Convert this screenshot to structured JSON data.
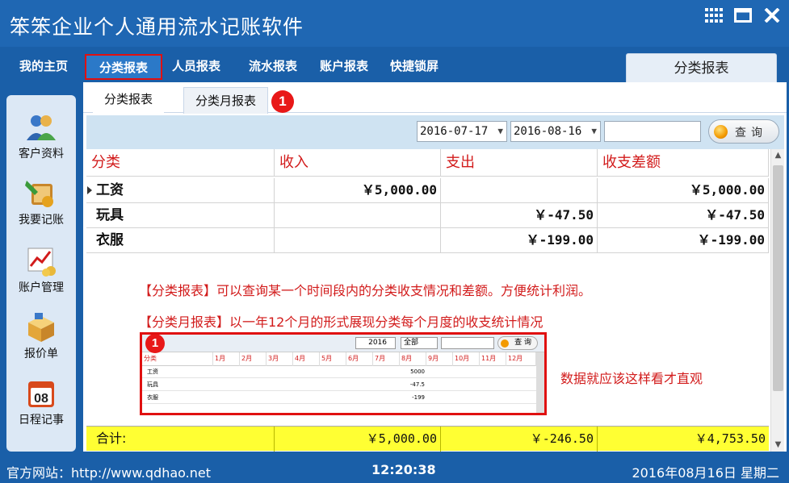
{
  "app": {
    "title": "笨笨企业个人通用流水记账软件"
  },
  "window_buttons": [
    "grid-icon",
    "maximize-icon",
    "close-icon"
  ],
  "nav": {
    "items": [
      "我的主页",
      "分类报表",
      "人员报表",
      "流水报表",
      "账户报表",
      "快捷锁屏"
    ],
    "active": "分类报表",
    "current_tab": "分类报表"
  },
  "sidebar": {
    "items": [
      {
        "label": "客户资料",
        "icon": "customer-icon"
      },
      {
        "label": "我要记账",
        "icon": "bookkeeping-icon"
      },
      {
        "label": "账户管理",
        "icon": "account-chart-icon"
      },
      {
        "label": "报价单",
        "icon": "quotation-box-icon"
      },
      {
        "label": "日程记事",
        "icon": "calendar-icon"
      }
    ]
  },
  "subtabs": {
    "items": [
      "分类报表",
      "分类月报表"
    ],
    "badge": "1"
  },
  "toolbar": {
    "start_date": "2016-07-17",
    "end_date": "2016-08-16",
    "search_value": "",
    "query_label": "查询"
  },
  "table": {
    "columns": [
      "分类",
      "收入",
      "支出",
      "收支差额"
    ],
    "rows": [
      {
        "category": "工资",
        "income": "￥5,000.00",
        "expense": "",
        "balance": "￥5,000.00"
      },
      {
        "category": "玩具",
        "income": "",
        "expense": "￥-47.50",
        "balance": "￥-47.50"
      },
      {
        "category": "衣服",
        "income": "",
        "expense": "￥-199.00",
        "balance": "￥-199.00"
      }
    ],
    "total": {
      "label": "合计:",
      "income": "￥5,000.00",
      "expense": "￥-246.50",
      "balance": "￥4,753.50"
    }
  },
  "annotations": {
    "line1": "【分类报表】可以查询某一个时间段内的分类收支情况和差额。方便统计利润。",
    "line2": "【分类月报表】以一年12个月的形式展现分类每个月度的收支统计情况",
    "side_note": "数据就应该这样看才直观"
  },
  "preview": {
    "badge": "1",
    "year": "2016",
    "scope": "全部",
    "query_label": "查 询",
    "columns": [
      "分类",
      "1月",
      "2月",
      "3月",
      "4月",
      "5月",
      "6月",
      "7月",
      "8月",
      "9月",
      "10月",
      "11月",
      "12月"
    ],
    "rows": [
      {
        "category": "工资",
        "aug": "5000"
      },
      {
        "category": "玩具",
        "aug": "-47.5"
      },
      {
        "category": "衣服",
        "aug": "-199"
      }
    ]
  },
  "status": {
    "website": "官方网站：http://www.qdhao.net",
    "time": "12:20:38",
    "date": "2016年08月16日  星期二"
  }
}
